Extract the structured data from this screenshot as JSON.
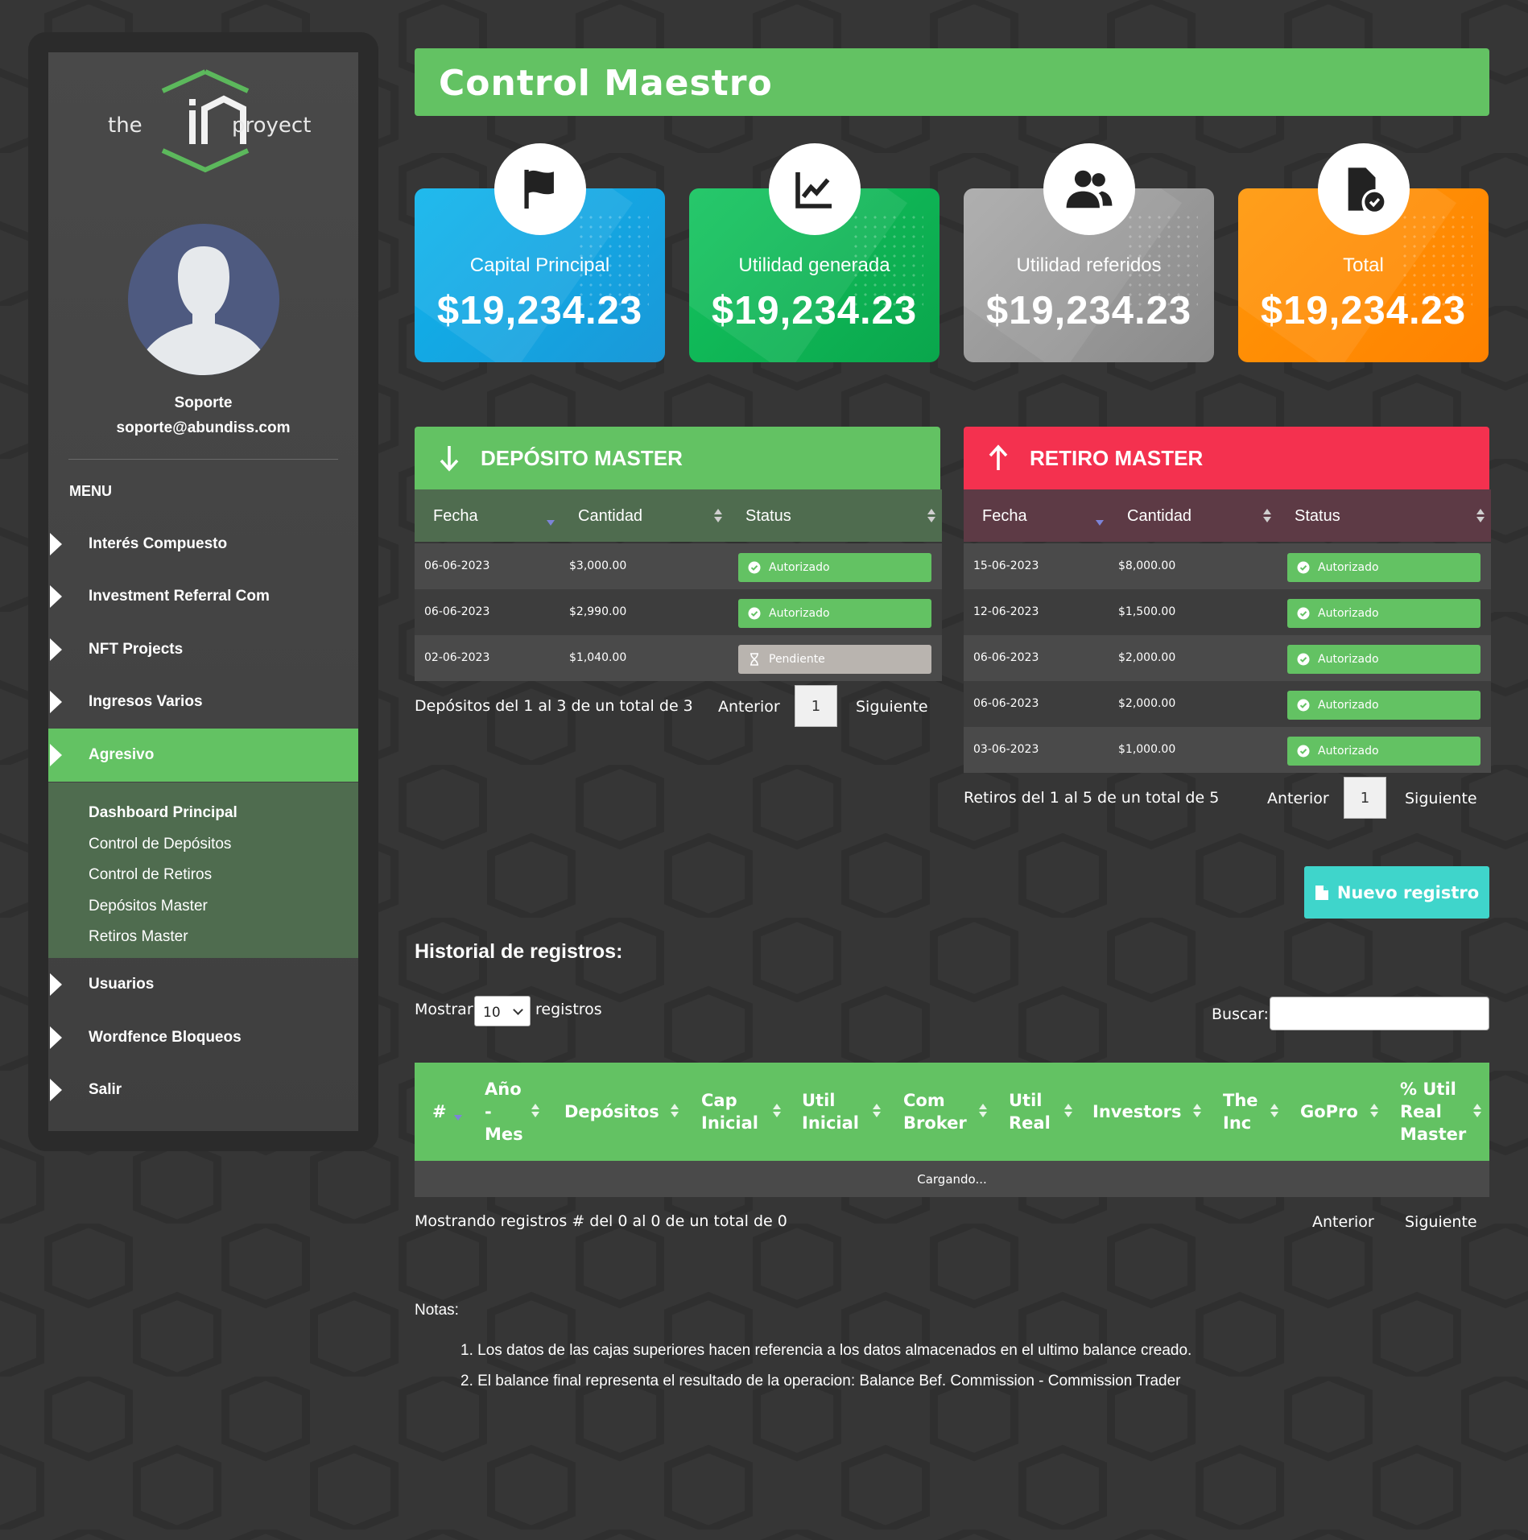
{
  "brand": {
    "logo_left": "the",
    "logo_right": "proyect"
  },
  "user": {
    "name": "Soporte",
    "email": "soporte@abundiss.com"
  },
  "sidebar": {
    "menu_label": "MENU",
    "items": [
      {
        "label": "Interés Compuesto"
      },
      {
        "label": "Investment Referral Com"
      },
      {
        "label": "NFT Projects"
      },
      {
        "label": "Ingresos Varios"
      },
      {
        "label": "Agresivo"
      },
      {
        "label": "Usuarios"
      },
      {
        "label": "Wordfence Bloqueos"
      },
      {
        "label": "Salir"
      }
    ],
    "submenu": [
      {
        "label": "Dashboard Principal"
      },
      {
        "label": "Control de Depósitos"
      },
      {
        "label": "Control de Retiros"
      },
      {
        "label": "Depósitos Master"
      },
      {
        "label": "Retiros Master"
      }
    ]
  },
  "page_title": "Control Maestro",
  "cards": [
    {
      "label": "Capital Principal",
      "value": "$19,234.23",
      "icon": "flag-icon",
      "color": "#1aa7e4"
    },
    {
      "label": "Utilidad generada",
      "value": "$19,234.23",
      "icon": "chart-line-icon",
      "color": "#0fb656"
    },
    {
      "label": "Utilidad referidos",
      "value": "$19,234.23",
      "icon": "users-icon",
      "color": "#9e9e9e"
    },
    {
      "label": "Total",
      "value": "$19,234.23",
      "icon": "file-check-icon",
      "color": "#ff8c00"
    }
  ],
  "deposit": {
    "title": "DEPÓSITO MASTER",
    "columns": [
      "Fecha",
      "Cantidad",
      "Status"
    ],
    "rows": [
      {
        "fecha": "06-06-2023",
        "cantidad": "$3,000.00",
        "status": "Autorizado"
      },
      {
        "fecha": "06-06-2023",
        "cantidad": "$2,990.00",
        "status": "Autorizado"
      },
      {
        "fecha": "02-06-2023",
        "cantidad": "$1,040.00",
        "status": "Pendiente"
      }
    ],
    "info": "Depósitos del 1 al 3 de un total de 3",
    "prev": "Anterior",
    "page": "1",
    "next": "Siguiente"
  },
  "withdraw": {
    "title": "RETIRO MASTER",
    "columns": [
      "Fecha",
      "Cantidad",
      "Status"
    ],
    "rows": [
      {
        "fecha": "15-06-2023",
        "cantidad": "$8,000.00",
        "status": "Autorizado"
      },
      {
        "fecha": "12-06-2023",
        "cantidad": "$1,500.00",
        "status": "Autorizado"
      },
      {
        "fecha": "06-06-2023",
        "cantidad": "$2,000.00",
        "status": "Autorizado"
      },
      {
        "fecha": "06-06-2023",
        "cantidad": "$2,000.00",
        "status": "Autorizado"
      },
      {
        "fecha": "03-06-2023",
        "cantidad": "$1,000.00",
        "status": "Autorizado"
      }
    ],
    "info": "Retiros del 1 al 5 de un total de 5",
    "prev": "Anterior",
    "page": "1",
    "next": "Siguiente"
  },
  "new_record_button": "Nuevo registro",
  "history": {
    "title": "Historial de registros:",
    "show_label": "Mostrar",
    "show_value": "10",
    "show_suffix": "registros",
    "search_label": "Buscar:",
    "search_value": "",
    "columns": [
      {
        "lines": [
          "#"
        ]
      },
      {
        "lines": [
          "Año",
          "-",
          "Mes"
        ]
      },
      {
        "lines": [
          "Depósitos"
        ]
      },
      {
        "lines": [
          "Cap",
          "Inicial"
        ]
      },
      {
        "lines": [
          "Util",
          "Inicial"
        ]
      },
      {
        "lines": [
          "Com",
          "Broker"
        ]
      },
      {
        "lines": [
          "Util",
          "Real"
        ]
      },
      {
        "lines": [
          "Investors"
        ]
      },
      {
        "lines": [
          "The",
          "Inc"
        ]
      },
      {
        "lines": [
          "GoPro"
        ]
      },
      {
        "lines": [
          "% Util",
          "Real",
          "Master"
        ]
      }
    ],
    "loading": "Cargando...",
    "info": "Mostrando registros # del 0 al 0 de un total de 0",
    "prev": "Anterior",
    "next": "Siguiente"
  },
  "notes": {
    "label": "Notas:",
    "items": [
      "1. Los datos de las cajas superiores hacen referencia a los datos almacenados en el ultimo balance creado.",
      "2. El balance final representa el resultado de la operacion: Balance Bef. Commission - Commission Trader"
    ]
  },
  "colors": {
    "accent_green": "#63c263",
    "danger_red": "#f4314f",
    "teal": "#3fd5cb",
    "background": "#363636"
  }
}
